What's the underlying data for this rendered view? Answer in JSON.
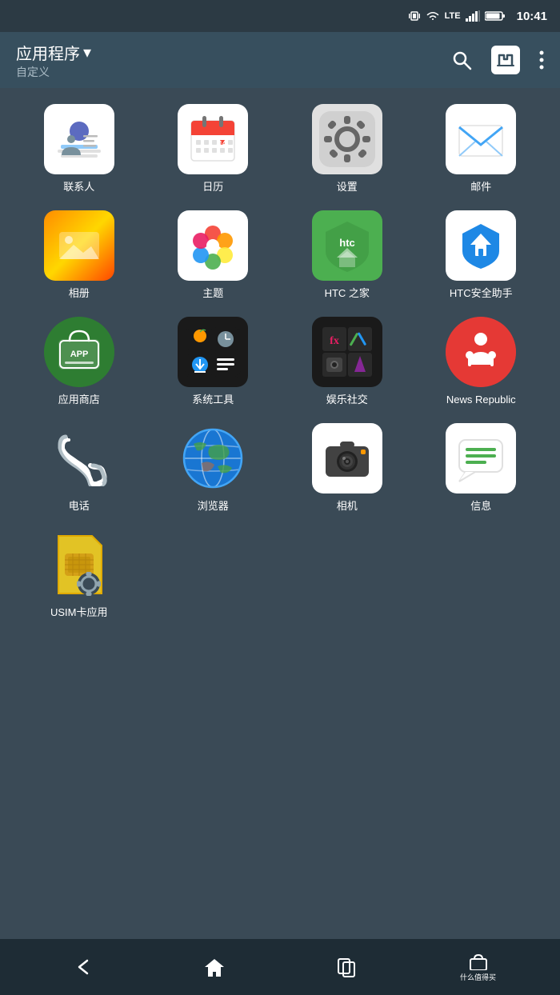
{
  "statusBar": {
    "time": "10:41",
    "icons": [
      "vibrate",
      "wifi",
      "lte",
      "signal",
      "battery"
    ]
  },
  "topBar": {
    "title": "应用程序",
    "dropdown": "▾",
    "subtitle": "自定义",
    "searchLabel": "search",
    "shopLabel": "HTC",
    "moreLabel": "more"
  },
  "apps": [
    {
      "id": "contacts",
      "label": "联系人",
      "type": "contacts"
    },
    {
      "id": "calendar",
      "label": "日历",
      "type": "calendar"
    },
    {
      "id": "settings",
      "label": "设置",
      "type": "settings"
    },
    {
      "id": "email",
      "label": "邮件",
      "type": "email"
    },
    {
      "id": "gallery",
      "label": "相册",
      "type": "gallery"
    },
    {
      "id": "themes",
      "label": "主题",
      "type": "themes"
    },
    {
      "id": "htchome",
      "label": "HTC 之家",
      "type": "htchome"
    },
    {
      "id": "htcsecurity",
      "label": "HTC安全助手",
      "type": "htcsecurity"
    },
    {
      "id": "appstore",
      "label": "应用商店",
      "type": "appstore"
    },
    {
      "id": "systemtools",
      "label": "系统工具",
      "type": "systemtools"
    },
    {
      "id": "entertainment",
      "label": "娱乐社交",
      "type": "entertainment"
    },
    {
      "id": "newsrepublic",
      "label": "News Republic",
      "type": "newsrepublic"
    },
    {
      "id": "phone",
      "label": "电话",
      "type": "phone"
    },
    {
      "id": "browser",
      "label": "浏览器",
      "type": "browser"
    },
    {
      "id": "camera",
      "label": "相机",
      "type": "camera"
    },
    {
      "id": "messages",
      "label": "信息",
      "type": "messages"
    },
    {
      "id": "usim",
      "label": "USIM卡应用",
      "type": "usim"
    }
  ],
  "navBar": {
    "back": "↩",
    "home": "⌂",
    "recent": "▣",
    "watermark": "什么值得买"
  }
}
